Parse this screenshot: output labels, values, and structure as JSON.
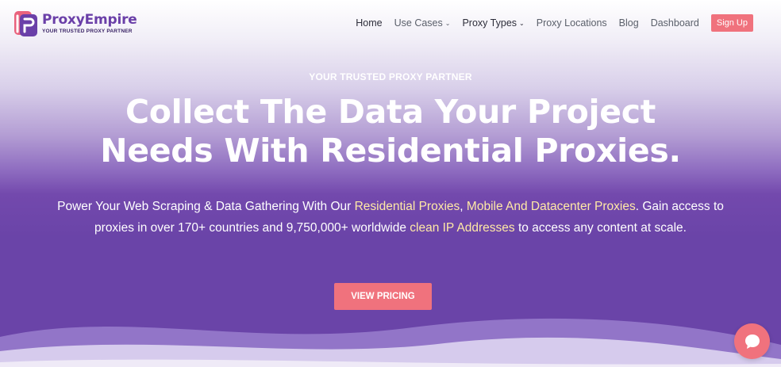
{
  "brand": {
    "name": "ProxyEmpire",
    "tagline": "YOUR TRUSTED PROXY PARTNER"
  },
  "nav": {
    "home": "Home",
    "use_cases": "Use Cases",
    "proxy_types": "Proxy Types",
    "proxy_locations": "Proxy Locations",
    "blog": "Blog",
    "dashboard": "Dashboard",
    "signup": "Sign Up"
  },
  "hero": {
    "eyebrow": "YOUR TRUSTED PROXY PARTNER",
    "headline_line1": "Collect The Data Your Project",
    "headline_line2": "Needs With Residential Proxies.",
    "sub_part1": "Power Your Web Scraping & Data Gathering With Our ",
    "sub_link1": "Residential Proxies",
    "sub_part2": ", ",
    "sub_link2": "Mobile And Datacenter Proxies",
    "sub_part3": ". Gain access to proxies in over 170+ countries and 9,750,000+ worldwide ",
    "sub_link3": "clean IP Addresses",
    "sub_part4": " to access any content at scale.",
    "cta": "VIEW PRICING"
  },
  "colors": {
    "accent": "#f0727d",
    "purple": "#6a44a8",
    "link_highlight": "#ffe9a6"
  },
  "icons": {
    "logo": "proxyempire-logo-mark",
    "chat": "chat-bubble-icon",
    "chevron": "chevron-down-icon"
  }
}
